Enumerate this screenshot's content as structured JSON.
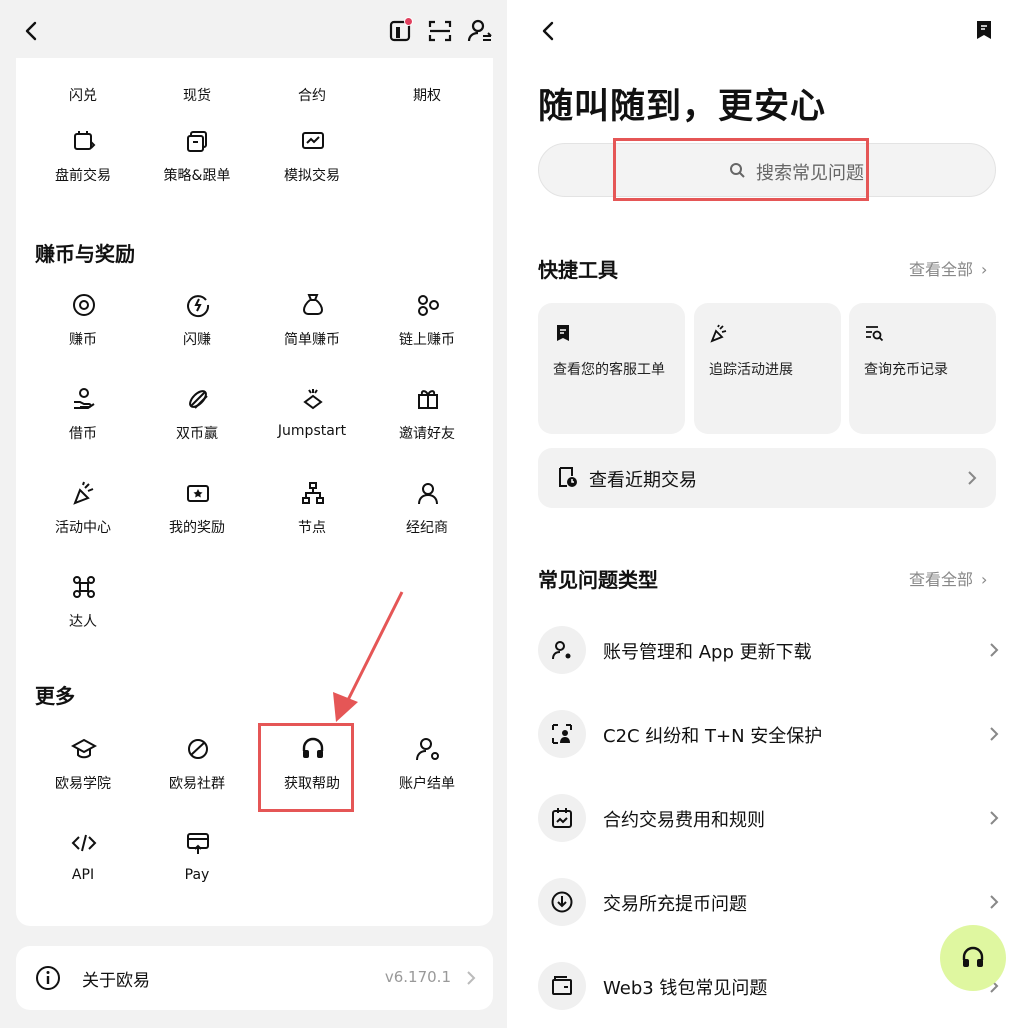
{
  "left": {
    "top_row": [
      "闪兑",
      "现货",
      "合约",
      "期权"
    ],
    "row2": [
      "盘前交易",
      "策略&跟单",
      "模拟交易"
    ],
    "section_earn": "赚币与奖励",
    "earn_items": [
      "赚币",
      "闪赚",
      "简单赚币",
      "链上赚币",
      "借币",
      "双币赢",
      "Jumpstart",
      "邀请好友",
      "活动中心",
      "我的奖励",
      "节点",
      "经纪商",
      "达人"
    ],
    "section_more": "更多",
    "more_items": [
      "欧易学院",
      "欧易社群",
      "获取帮助",
      "账户结单",
      "API",
      "Pay"
    ],
    "about": {
      "label": "关于欧易",
      "version": "v6.170.1"
    }
  },
  "right": {
    "title": "随叫随到，更安心",
    "search_placeholder": "搜索常见问题",
    "quick_tools": {
      "title": "快捷工具",
      "view_all": "查看全部",
      "tools": [
        "查看您的客服工单",
        "追踪活动进展",
        "查询充币记录"
      ],
      "recent": "查看近期交易"
    },
    "faq": {
      "title": "常见问题类型",
      "view_all": "查看全部",
      "items": [
        "账号管理和 App 更新下载",
        "C2C 纠纷和 T+N 安全保护",
        "合约交易费用和规则",
        "交易所充提币问题",
        "Web3 钱包常见问题"
      ]
    }
  },
  "colors": {
    "highlight": "#e55656",
    "fab": "#dff7a0",
    "card_bg": "#f2f2f2"
  }
}
